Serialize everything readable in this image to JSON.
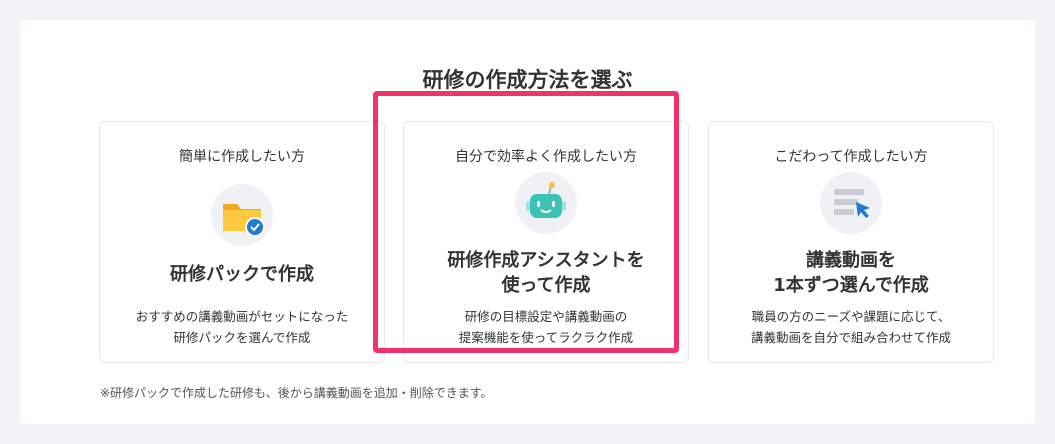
{
  "title": "研修の作成方法を選ぶ",
  "cards": [
    {
      "subtitle": "簡単に作成したい方",
      "heading_lines": [
        "研修パックで作成"
      ],
      "description_lines": [
        "おすすめの講義動画がセットになった",
        "研修パックを選んで作成"
      ],
      "icon": "folder-check-icon"
    },
    {
      "subtitle": "自分で効率よく作成したい方",
      "heading_lines": [
        "研修作成アシスタントを",
        "使って作成"
      ],
      "description_lines": [
        "研修の目標設定や講義動画の",
        "提案機能を使ってラクラク作成"
      ],
      "icon": "robot-icon",
      "highlighted": true
    },
    {
      "subtitle": "こだわって作成したい方",
      "heading_lines": [
        "講義動画を",
        "1本ずつ選んで作成"
      ],
      "description_lines": [
        "職員の方のニーズや課題に応じて、",
        "講義動画を自分で組み合わせて作成"
      ],
      "icon": "list-cursor-icon"
    }
  ],
  "note": "※研修パックで作成した研修も、後から講義動画を追加・削除できます。",
  "colors": {
    "highlight": "#f0346b",
    "page_bg": "#f1f3f7",
    "accent_blue": "#1e7bd0",
    "folder_yellow": "#f7b733",
    "robot_teal": "#3cc3b5"
  }
}
